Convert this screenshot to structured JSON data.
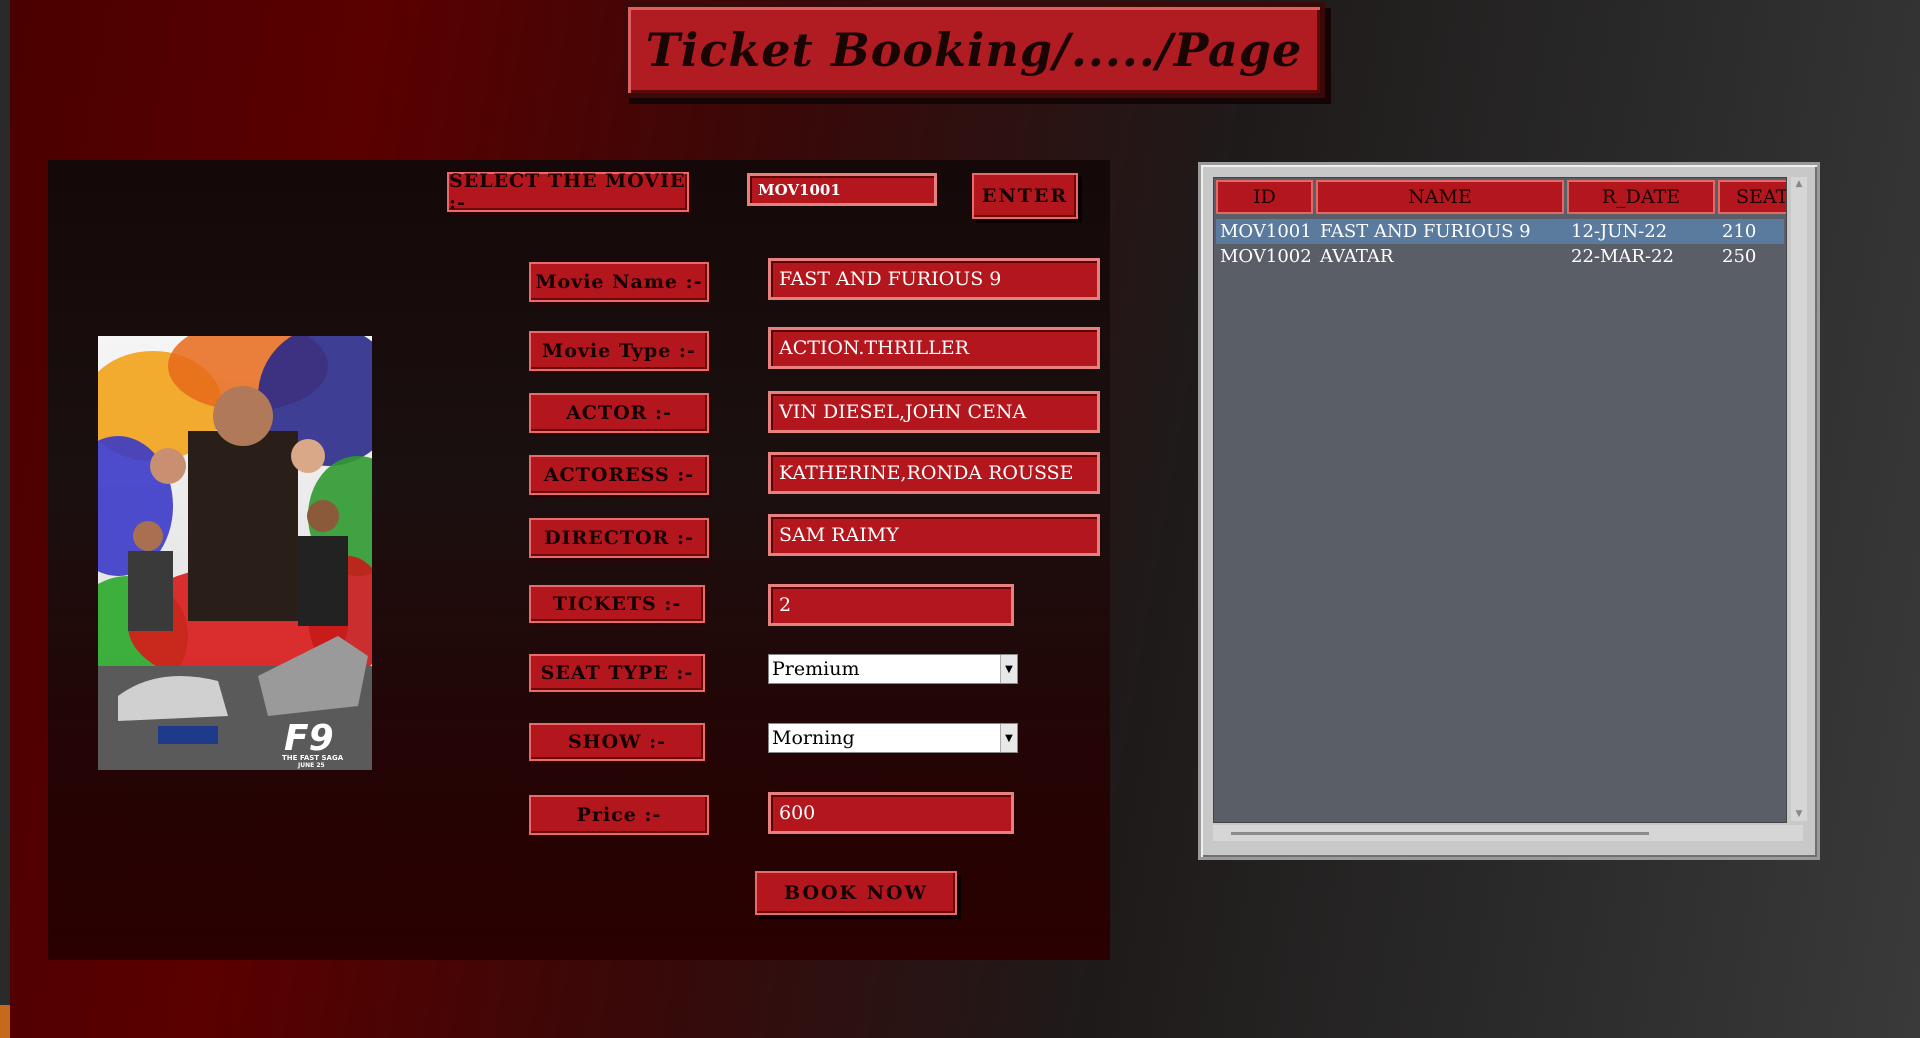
{
  "title": "Ticket Booking/...../Page",
  "selector": {
    "label": "SELECT THE MOVIE :-",
    "movie_id_value": "MOV1001",
    "enter_label": "ENTER"
  },
  "form": {
    "movie_name": {
      "label": "Movie Name :-",
      "value": "FAST AND FURIOUS 9"
    },
    "movie_type": {
      "label": "Movie Type :-",
      "value": "ACTION.THRILLER"
    },
    "actor": {
      "label": "ACTOR :-",
      "value": "VIN DIESEL,JOHN CENA"
    },
    "actress": {
      "label": "ACTORESS :-",
      "value": "KATHERINE,RONDA ROUSSE"
    },
    "director": {
      "label": "DIRECTOR :-",
      "value": "SAM RAIMY"
    },
    "tickets": {
      "label": "TICKETS :-",
      "value": "2"
    },
    "seat_type": {
      "label": "SEAT TYPE :-",
      "value": "Premium"
    },
    "show": {
      "label": "SHOW :-",
      "value": "Morning"
    },
    "price": {
      "label": "Price :-",
      "value": "600"
    }
  },
  "book_label": "BOOK NOW",
  "poster": {
    "title_text": "F9",
    "tagline": "THE FAST SAGA",
    "date": "JUNE 25"
  },
  "table": {
    "headers": [
      "ID",
      "NAME",
      "R_DATE",
      "SEAT"
    ],
    "rows": [
      [
        "MOV1001",
        "FAST AND FURIOUS 9",
        "12-JUN-22",
        "210"
      ],
      [
        "MOV1002",
        "AVATAR",
        "22-MAR-22",
        "250"
      ]
    ]
  },
  "colors": {
    "accent": "#b3161c",
    "selected_row": "#5a7a9e"
  }
}
